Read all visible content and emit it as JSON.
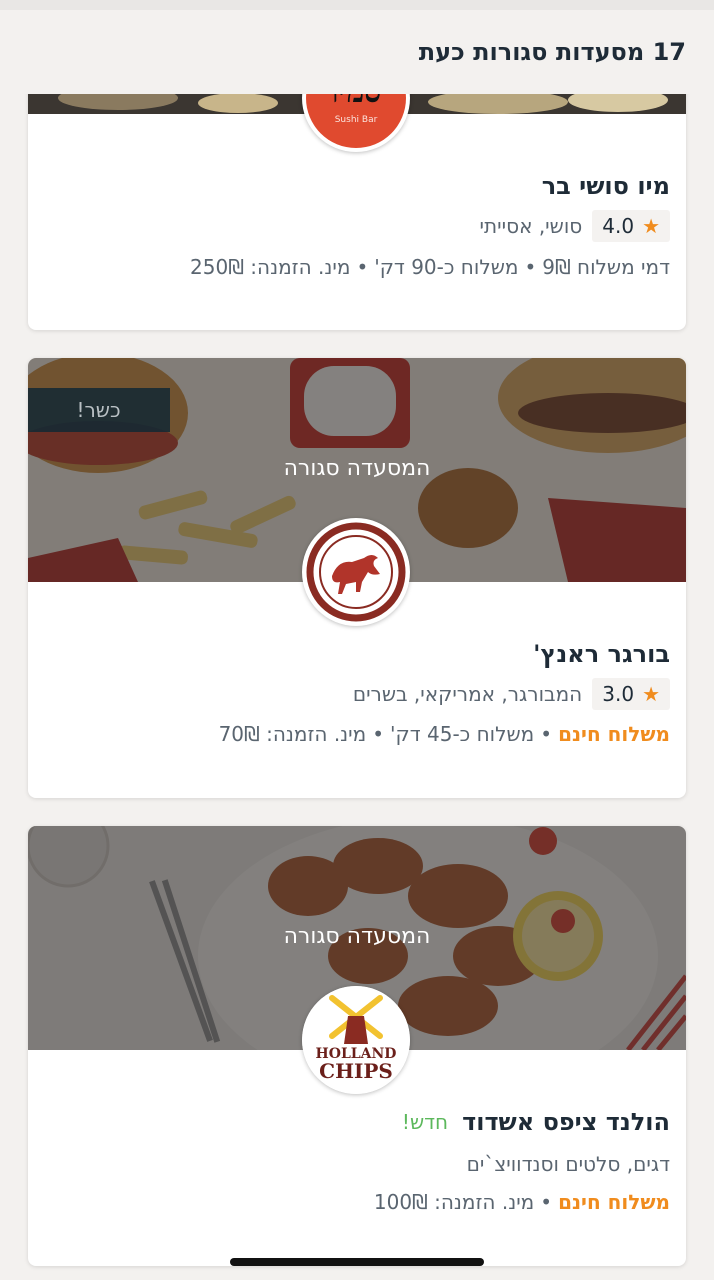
{
  "header": {
    "title": "17 מסעדות סגורות כעת"
  },
  "restaurants": [
    {
      "name": "מיו סושי בר",
      "rating": "4.0",
      "cuisine": "סושי, אסייתי",
      "delivery_fee": "דמי משלוח 9₪",
      "delivery_time": "משלוח כ-90 דק'",
      "min_order": "מינ. הזמנה: 250₪",
      "logo_text": "סמיו",
      "logo_subtext": "Sushi Bar"
    },
    {
      "name": "בורגר ראנץ'",
      "rating": "3.0",
      "cuisine": "המבורגר, אמריקאי, בשרים",
      "delivery_fee": "משלוח חינם",
      "delivery_time": "משלוח כ-45 דק'",
      "min_order": "מינ. הזמנה: 70₪",
      "closed_label": "המסעדה סגורה",
      "kosher_label": "כשר!"
    },
    {
      "name": "הולנד ציפס אשדוד",
      "new_badge": "חדש!",
      "cuisine": "דגים, סלטים וסנדוויצ`ים",
      "delivery_fee": "משלוח חינם",
      "min_order": "מינ. הזמנה: 100₪",
      "closed_label": "המסעדה סגורה",
      "logo_text_1": "HOLLAND",
      "logo_text_2": "CHIPS"
    }
  ],
  "colors": {
    "accent": "#f08c1e",
    "new": "#5cb85c",
    "title": "#1e2b37"
  },
  "icons": [
    "star-icon",
    "bull-logo-icon",
    "windmill-logo-icon"
  ]
}
